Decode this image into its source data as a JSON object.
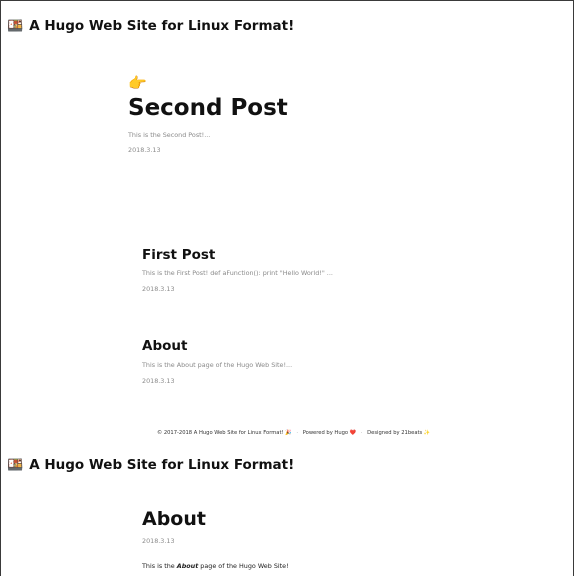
{
  "site": {
    "title": "A Hugo Web Site for Linux Format!",
    "emoji": "🍱"
  },
  "featured": {
    "icon": "pointing-hand-icon",
    "icon_glyph": "👉",
    "title": "Second Post",
    "summary": "This is the Second Post!...",
    "date": "2018.3.13"
  },
  "posts": [
    {
      "title": "First Post",
      "summary": "This is the First Post! def aFunction(): print \"Hello World!\" ...",
      "date": "2018.3.13"
    },
    {
      "title": "About",
      "summary": "This is the About page of the Hugo Web Site!...",
      "date": "2018.3.13"
    }
  ],
  "footer": {
    "copyright": "© 2017-2018 A Hugo Web Site for Linux Format!",
    "copyright_emoji": "🎉",
    "separator": "·",
    "powered": "Powered by Hugo",
    "powered_emoji": "❤️",
    "designed": "Designed by 21beats",
    "designed_emoji": "✨"
  },
  "about_page": {
    "title": "About",
    "date": "2018.3.13",
    "body_before": "This is the ",
    "body_emphasis": "About",
    "body_after": " page of the Hugo Web Site!"
  }
}
